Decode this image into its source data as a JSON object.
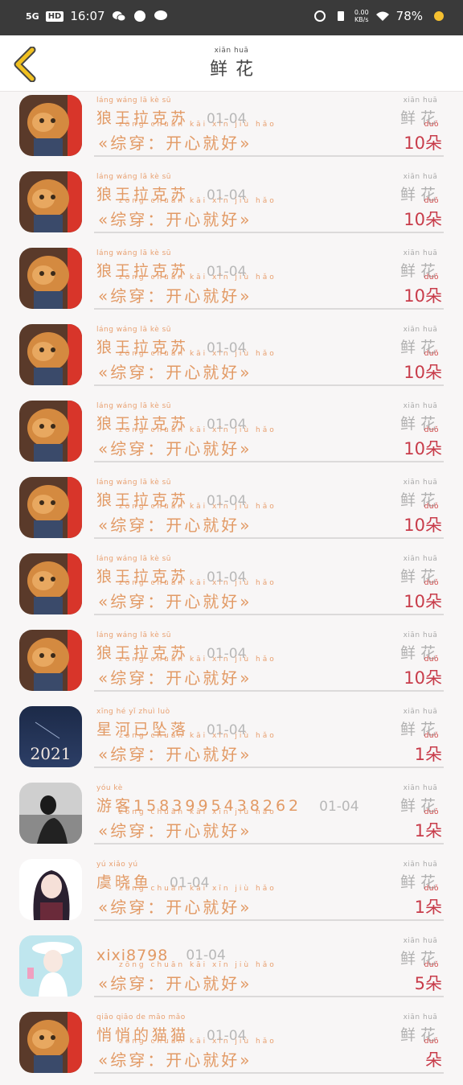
{
  "status_bar": {
    "network": "5G",
    "signal": "4G",
    "hd": "HD",
    "time": "16:07",
    "net_speed_value": "0.00",
    "net_speed_unit": "KB/s",
    "battery": "78%"
  },
  "header": {
    "title_pinyin": "xiān  huā",
    "title": "鲜花"
  },
  "flower_label": {
    "pinyin": "xiān  huā",
    "text": "鲜花"
  },
  "unit_label": {
    "pinyin": "duǒ",
    "text": "朵"
  },
  "message": {
    "pinyin": "zōng chuān   kāi  xīn  jiù  hǎo",
    "text": "«综穿：开心就好»"
  },
  "rows": [
    {
      "avatar": "cat",
      "name_pinyin": "láng wáng  lā   kè   sū",
      "name": "狼王拉克苏",
      "date": "01-04",
      "count": "10"
    },
    {
      "avatar": "cat",
      "name_pinyin": "láng wáng  lā   kè   sū",
      "name": "狼王拉克苏",
      "date": "01-04",
      "count": "10"
    },
    {
      "avatar": "cat",
      "name_pinyin": "láng wáng  lā   kè   sū",
      "name": "狼王拉克苏",
      "date": "01-04",
      "count": "10"
    },
    {
      "avatar": "cat",
      "name_pinyin": "láng wáng  lā   kè   sū",
      "name": "狼王拉克苏",
      "date": "01-04",
      "count": "10"
    },
    {
      "avatar": "cat",
      "name_pinyin": "láng wáng  lā   kè   sū",
      "name": "狼王拉克苏",
      "date": "01-04",
      "count": "10"
    },
    {
      "avatar": "cat",
      "name_pinyin": "láng wáng  lā   kè   sū",
      "name": "狼王拉克苏",
      "date": "01-04",
      "count": "10"
    },
    {
      "avatar": "cat",
      "name_pinyin": "láng wáng  lā   kè   sū",
      "name": "狼王拉克苏",
      "date": "01-04",
      "count": "10"
    },
    {
      "avatar": "cat",
      "name_pinyin": "láng wáng  lā   kè   sū",
      "name": "狼王拉克苏",
      "date": "01-04",
      "count": "10"
    },
    {
      "avatar": "night",
      "name_pinyin": "xīng  hé   yǐ  zhuì luò",
      "name": "星河已坠落",
      "date": "01-04",
      "count": "1",
      "avatar_text": "2021"
    },
    {
      "avatar": "gray",
      "name_pinyin": "yóu  kè",
      "name": "游客1583995438262",
      "date": "01-04",
      "count": "1"
    },
    {
      "avatar": "girl",
      "name_pinyin": "yú  xiǎo  yú",
      "name": "虞晓鱼",
      "date": "01-04",
      "count": "1"
    },
    {
      "avatar": "girl2",
      "name_pinyin": "",
      "name": "xixi8798",
      "date": "01-04",
      "count": "5"
    },
    {
      "avatar": "cat2",
      "name_pinyin": "qiāo qiāo  de  māo  mǎo",
      "name": "悄悄的猫猫",
      "date": "01-04",
      "count": ""
    }
  ],
  "colors": {
    "accent": "#e29a65",
    "count": "#c83c4a",
    "back_arrow": "#f0c020"
  }
}
